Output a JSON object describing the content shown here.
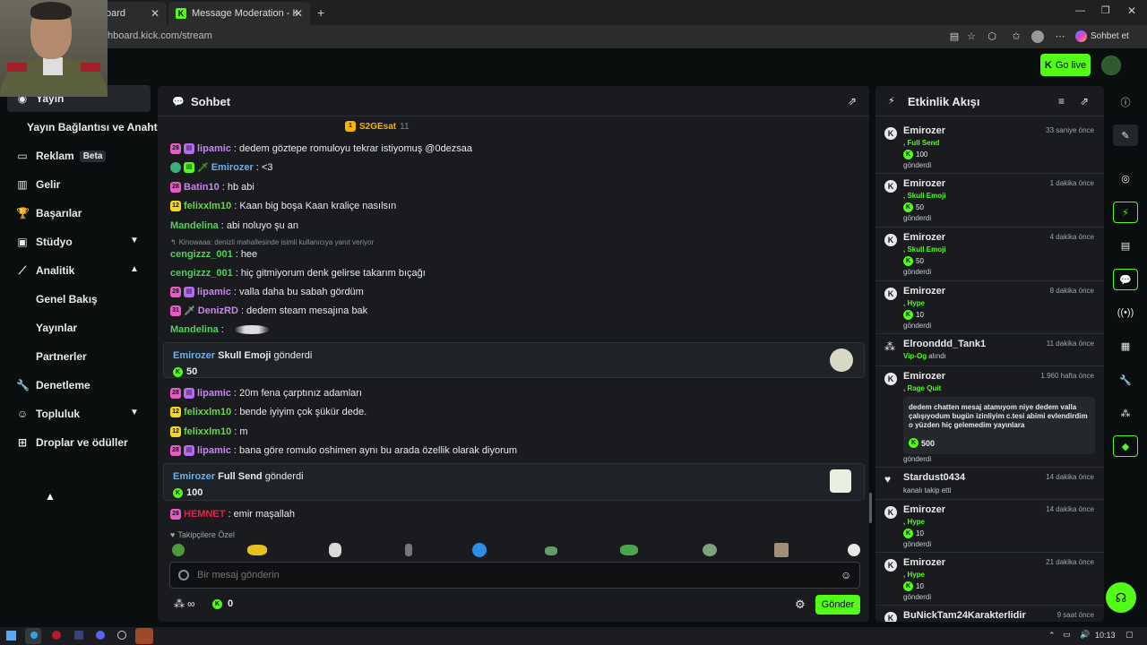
{
  "browser": {
    "tab1_label": "oard",
    "tab2_label": "Message Moderation - Kick Dashb",
    "url": "hboard.kick.com/stream",
    "profile_label": "Sohbet et",
    "window_controls": [
      "minimize",
      "maximize",
      "close"
    ]
  },
  "header": {
    "go_live_label": "Go live"
  },
  "sidebar": {
    "items": [
      {
        "label": "Yayın",
        "icon": "broadcast-icon"
      },
      {
        "label": "Yayın Bağlantısı ve Anahtarı"
      },
      {
        "label": "Reklam",
        "badge": "Beta",
        "icon": "monitor-icon"
      },
      {
        "label": "Gelir",
        "icon": "chart-icon"
      },
      {
        "label": "Başarılar",
        "icon": "trophy-icon"
      },
      {
        "label": "Stüdyo",
        "icon": "studio-icon"
      },
      {
        "label": "Analitik",
        "icon": "analytics-icon"
      },
      {
        "label": "Genel Bakış"
      },
      {
        "label": "Yayınlar"
      },
      {
        "label": "Partnerler"
      },
      {
        "label": "Denetleme",
        "icon": "wrench-icon"
      },
      {
        "label": "Topluluk",
        "icon": "community-icon"
      },
      {
        "label": "Droplar ve ödüller",
        "icon": "gift-icon"
      }
    ]
  },
  "chat": {
    "title": "Sohbet",
    "pinned_user": "S2GEsat",
    "pinned_count": "11",
    "messages": [
      {
        "user": "lipamic",
        "text": ": dedem göztepe romuloyu tekrar istiyomuş @0dezsaa",
        "color": "#c885f0"
      },
      {
        "user": "Emirozer",
        "text": ": <3",
        "color": "#6ab0f3"
      },
      {
        "user": "Batin10",
        "text": ": hb abi",
        "color": "#c885f0"
      },
      {
        "user": "felixxlm10",
        "text": ": Kaan big boşa Kaan kraliçe nasılsın",
        "color": "#6bd64c"
      },
      {
        "user": "Mandelina",
        "text": ": abi noluyo şu an",
        "color": "#53d05c"
      },
      {
        "reply": "Kinowaaa: denizli mahallesinde isimli kullanıcıya yanıt veriyor"
      },
      {
        "user": "cengizzz_001",
        "text": ": hee",
        "color": "#53d05c"
      },
      {
        "user": "cengizzz_001",
        "text": ": hiç gitmiyorum denk gelirse takarım bıçağı",
        "color": "#53d05c"
      },
      {
        "user": "lipamic",
        "text": ": valla daha bu sabah gördüm",
        "color": "#c885f0"
      },
      {
        "user": "DenizRD",
        "text": ": dedem steam mesajına bak",
        "color": "#c885f0"
      },
      {
        "user": "Mandelina",
        "text": ":",
        "color": "#53d05c"
      },
      {
        "user": "lipamic",
        "text": ": 20m fena çarptınız adamları",
        "color": "#c885f0"
      },
      {
        "user": "felixxlm10",
        "text": ": bende iyiyim çok şükür dede.",
        "color": "#6bd64c"
      },
      {
        "user": "felixxlm10",
        "text": ": m",
        "color": "#6bd64c"
      },
      {
        "user": "lipamic",
        "text": ": bana göre romulo oshimen aynı bu arada özellik olarak diyorum",
        "color": "#c885f0"
      },
      {
        "user": "HEMNET",
        "text": ": emir maşallah",
        "color": "#e0234a"
      }
    ],
    "gifts": [
      {
        "user": "Emirozer",
        "item": "Skull Emoji",
        "suffix": " gönderdi",
        "amount": "50"
      },
      {
        "user": "Emirozer",
        "item": "Full Send",
        "suffix": " gönderdi",
        "amount": "100"
      }
    ],
    "followers_only_label": "Takipçilere Özel",
    "input_placeholder": "Bir mesaj gönderin",
    "infinity": "∞",
    "kicks_count": "0",
    "send_label": "Gönder"
  },
  "activity": {
    "title": "Etkinlik Akışı",
    "events": [
      {
        "name": "Emirozer",
        "time": "33 saniye önce",
        "item": ", Full Send",
        "amount": "100",
        "sent": "gönderdi"
      },
      {
        "name": "Emirozer",
        "time": "1 dakika önce",
        "item": ", Skull Emoji",
        "amount": "50",
        "sent": "gönderdi"
      },
      {
        "name": "Emirozer",
        "time": "4 dakika önce",
        "item": ", Skull Emoji",
        "amount": "50",
        "sent": "gönderdi"
      },
      {
        "name": "Emirozer",
        "time": "8 dakika önce",
        "item": ", Hype",
        "amount": "10",
        "sent": "gönderdi"
      },
      {
        "name": "Elroonddd_Tank1",
        "time": "11 dakika önce",
        "item": "Vip-Og",
        "suffix": " alındı"
      },
      {
        "name": "Emirozer",
        "time": "1.960 hafta önce",
        "item": ", Rage Quit",
        "message": "dedem chatten mesaj atamıyom niye dedem valla çalışıyodum bugün izinliyim c.tesi abimi evlendirdim o yüzden hiç gelemedim yayınlara",
        "amount": "500",
        "sent": "gönderdi"
      },
      {
        "name": "Stardust0434",
        "time": "14 dakika önce",
        "sub": "kanalı takip etti"
      },
      {
        "name": "Emirozer",
        "time": "14 dakika önce",
        "item": ", Hype",
        "amount": "10",
        "sent": "gönderdi"
      },
      {
        "name": "Emirozer",
        "time": "21 dakika önce",
        "item": ", Hype",
        "amount": "10",
        "sent": "gönderdi"
      },
      {
        "name": "BuNickTam24Karakterlidir",
        "time": "9 saat önce"
      }
    ]
  },
  "taskbar": {
    "time": "10:13"
  },
  "colors": {
    "accent": "#53fc18",
    "panel": "#191b1f",
    "background": "#0b0e0f"
  }
}
